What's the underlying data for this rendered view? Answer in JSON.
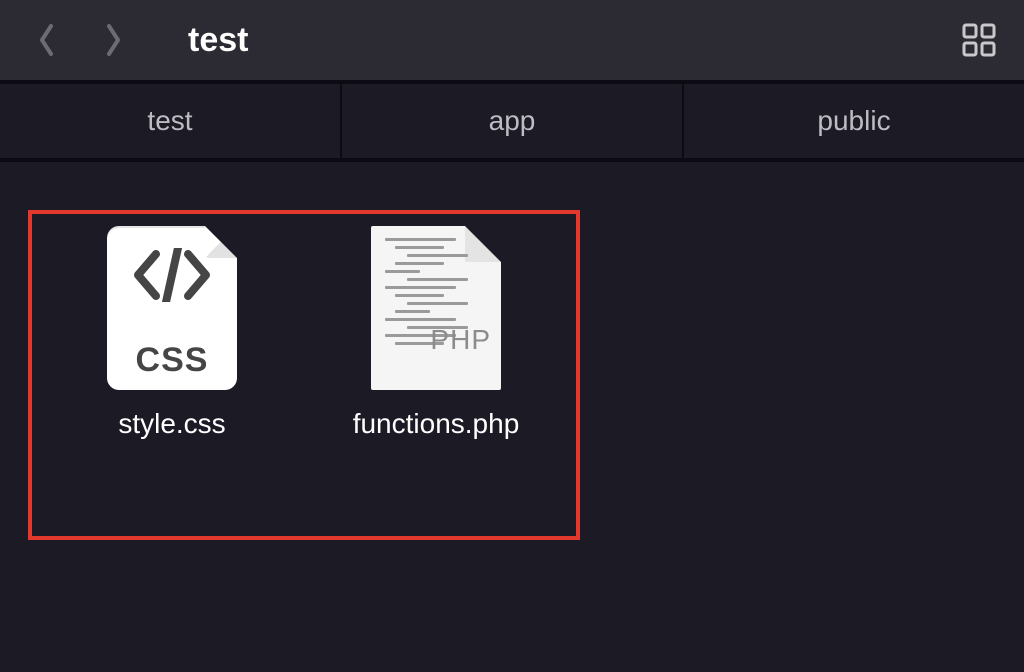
{
  "toolbar": {
    "title": "test"
  },
  "crumbs": [
    {
      "label": "test"
    },
    {
      "label": "app"
    },
    {
      "label": "public"
    }
  ],
  "files": [
    {
      "name": "style.css",
      "type": "css",
      "icon_text": "CSS"
    },
    {
      "name": "functions.php",
      "type": "php",
      "icon_text": "PHP"
    }
  ]
}
